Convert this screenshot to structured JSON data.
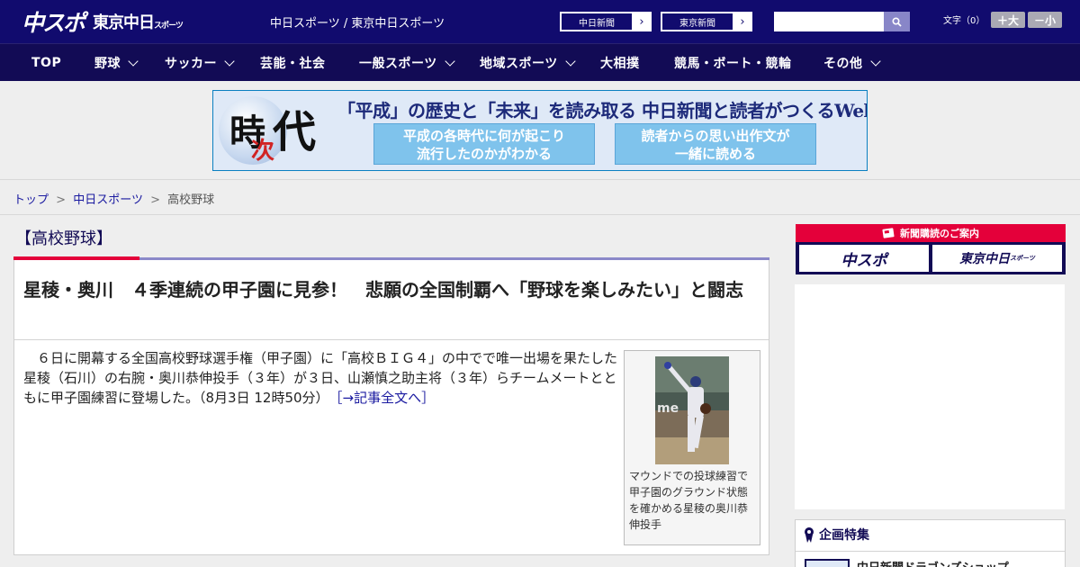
{
  "header": {
    "logo_main": "中スポ",
    "logo_sub": "東京中日",
    "logo_sub_small": "スポーツ",
    "site_title": "中日スポーツ / 東京中日スポーツ",
    "paper_buttons": [
      {
        "label": "中日新聞",
        "arrow": "›"
      },
      {
        "label": "東京新聞",
        "arrow": "›"
      }
    ],
    "search": {
      "placeholder": "",
      "value": ""
    },
    "font_size": {
      "label": "文字（0）",
      "increase": "＋大",
      "decrease": "－小"
    }
  },
  "nav": {
    "items": [
      {
        "label": "TOP",
        "dropdown": false
      },
      {
        "label": "野球",
        "dropdown": true
      },
      {
        "label": "サッカー",
        "dropdown": true
      },
      {
        "label": "芸能・社会",
        "dropdown": false
      },
      {
        "label": "一般スポーツ",
        "dropdown": true
      },
      {
        "label": "地域スポーツ",
        "dropdown": true
      },
      {
        "label": "大相撲",
        "dropdown": false
      },
      {
        "label": "競馬・ボート・競輪",
        "dropdown": false
      },
      {
        "label": "その他",
        "dropdown": true
      }
    ]
  },
  "banner": {
    "char1": "時",
    "char2": "次",
    "char3": "代",
    "headline": "「平成」の歴史と「未来」を読み取る 中日新聞と読者がつくるWebサイト",
    "box1_line1": "平成の各時代に何が起こり",
    "box1_line2": "流行したのかがわかる",
    "box2_line1": "読者からの思い出作文が",
    "box2_line2": "一緒に読める"
  },
  "breadcrumb": {
    "items": [
      "トップ",
      "中日スポーツ",
      "高校野球"
    ],
    "separator": ">"
  },
  "article": {
    "category": "【高校野球】",
    "headline": "星稜・奥川　４季連続の甲子園に見参！　悲願の全国制覇へ「野球を楽しみたい」と闘志",
    "body": "６日に開幕する全国高校野球選手権（甲子園）に「高校ＢＩＧ４」の中でで唯一出場を果たした星稜（石川）の右腕・奥川恭伸投手（３年）が３日、山瀬慎之助主将（３年）らチームメートとともに甲子園練習に登場した。（8月3日 12時50分）",
    "read_more": "［→記事全文へ］",
    "photo_caption": "マウンドでの投球練習で甲子園のグラウンド状態を確かめる星稜の奥川恭伸投手"
  },
  "sidebar": {
    "subscription_title": "新聞購読のご案内",
    "subscription_buttons": [
      "中スポ",
      "東京中日"
    ],
    "subscription_button_small": "スポーツ",
    "feature_title": "企画特集",
    "feature_item": "中日新聞ドラゴンズショップ"
  },
  "colors": {
    "header_bg": "#110b6e",
    "nav_bg": "#120b55",
    "accent_red": "#e4003a",
    "accent_purple": "#8b89c9",
    "link": "#1a1aa0"
  }
}
